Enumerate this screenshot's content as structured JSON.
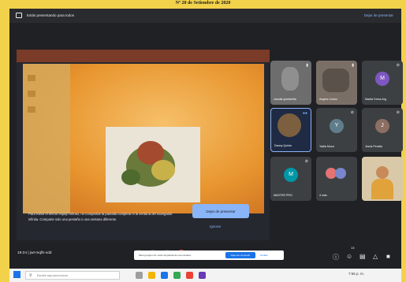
{
  "caption": "Nº 20 de Setiembre de 2020",
  "topbar": {
    "present_icon": "present-screen-icon",
    "title": "Estás presentando para todos",
    "stop_link": "Dejar de presentar"
  },
  "share_notice": {
    "text": "Para evitar el efecto espejo infinito, no compartas la pantalla completa ni la ventana del navegador infinita. Comparte solo una pestaña o una ventana diferente.",
    "stop_button": "Dejar de presentar",
    "ignore": "Ignorar"
  },
  "participants": [
    {
      "name": "claudia quintanilla",
      "type": "video",
      "mic": "on"
    },
    {
      "name": "Angela Lizano",
      "type": "video",
      "mic": "on"
    },
    {
      "name": "Marita Gress Arg",
      "type": "avatar",
      "initial": "M",
      "color": "#7e57c2",
      "mic": "off"
    },
    {
      "name": "Danny Quinto",
      "type": "video",
      "mic": "speaking"
    },
    {
      "name": "Yadia Muxa",
      "type": "avatar",
      "initial": "Y",
      "color": "#607d8b",
      "mic": "off"
    },
    {
      "name": "Jesús Peralta",
      "type": "avatar",
      "initial": "J",
      "color": "#8d6e63",
      "mic": "off"
    },
    {
      "name": "MASTER PRO",
      "type": "avatar",
      "initial": "M",
      "color": "#0097a7",
      "mic": "off"
    },
    {
      "name": "4 más",
      "type": "group",
      "mic": "off"
    },
    {
      "name": "",
      "type": "video",
      "mic": "off"
    }
  ],
  "bottom": {
    "time": "19:24",
    "meeting_code": "jwt-mqfb-xdd",
    "notification_text": "Meet google.com está compartiendo una ventana.",
    "notification_button": "Dejar de compartir",
    "notification_hide": "Ocultar",
    "right_icons": [
      "info-icon",
      "people-icon",
      "chat-icon",
      "activities-icon",
      "lock-icon"
    ],
    "participant_count": "13"
  },
  "taskbar": {
    "search_placeholder": "Escribe aquí para buscar",
    "time": "7:56 p. m."
  }
}
